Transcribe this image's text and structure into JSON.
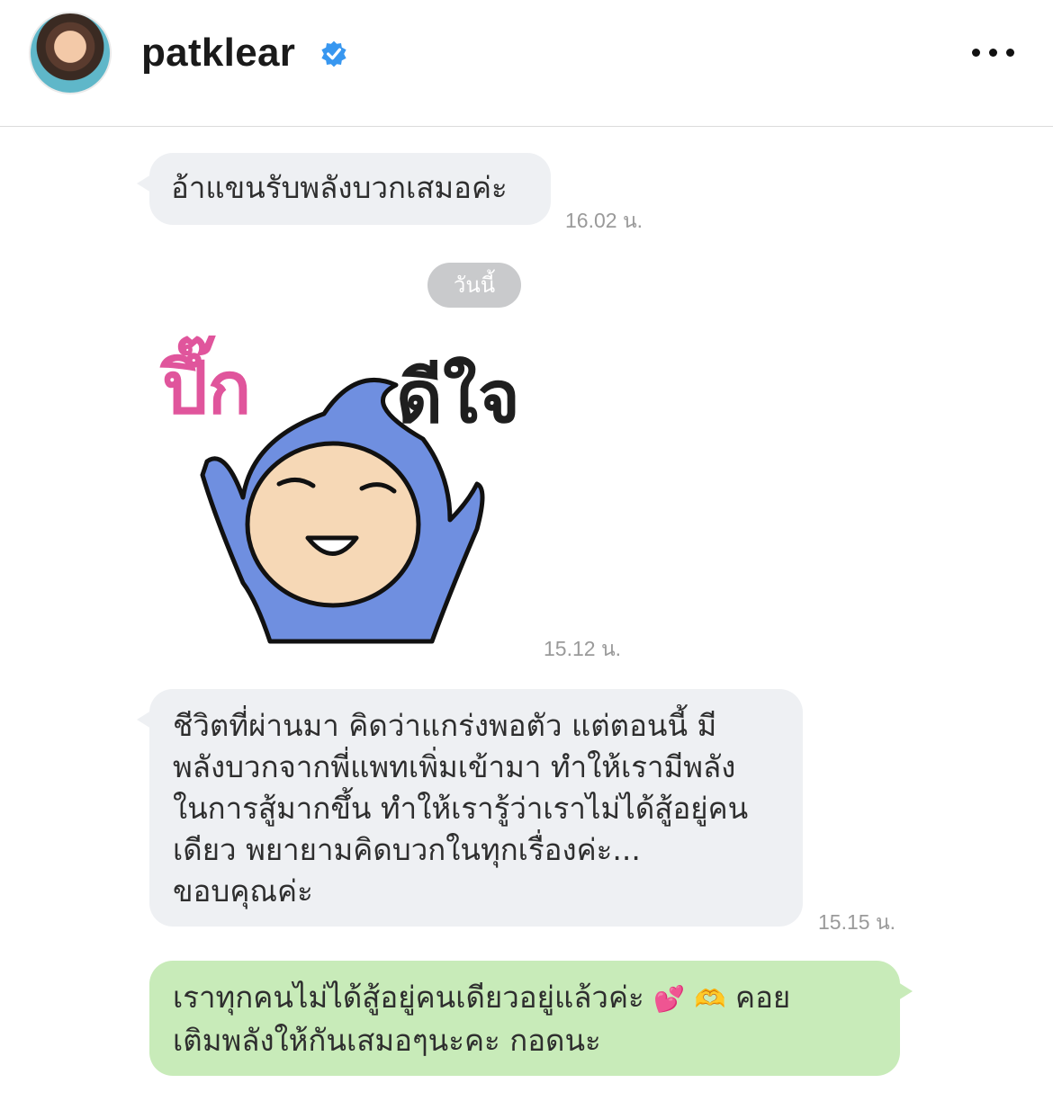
{
  "header": {
    "username": "patklear",
    "verified_icon": "verified-badge-icon",
    "more_icon": "more-options-icon"
  },
  "messages": [
    {
      "direction": "incoming",
      "text": "อ้าแขนรับพลังบวกเสมอค่ะ",
      "time": "16.02 น."
    },
    {
      "direction": "incoming",
      "type": "sticker",
      "sticker_text_left": "ปึ๊ก",
      "sticker_text_right": "ดีใจ",
      "time": "15.12 น."
    },
    {
      "direction": "incoming",
      "lines": [
        "ชีวิตที่ผ่านมา คิดว่าแกร่งพอตัว แต่ตอนนี้ มี",
        "พลังบวกจากพี่แพทเพิ่มเข้ามา ทำให้เรามีพลัง",
        "ในการสู้มากขึ้น ทำให้เรารู้ว่าเราไม่ได้สู้อยู่คน",
        "เดียว พยายามคิดบวกในทุกเรื่องค่ะ...",
        "ขอบคุณค่ะ"
      ],
      "time": "15.15 น."
    },
    {
      "direction": "outgoing",
      "line1_a": "เราทุกคนไม่ได้สู้อยู่คนเดียวอยู่แล้วค่ะ",
      "emoji1": "💕",
      "emoji2": "🫶",
      "line1_b": "คอย",
      "line2": "เติมพลังให้กันเสมอๆนะคะ กอดนะ"
    }
  ],
  "date_separator": "วันนี้",
  "colors": {
    "incoming_bubble": "#eef0f3",
    "outgoing_bubble": "#c8ebb9",
    "verified_blue": "#3897f0",
    "sticker_pink": "#e0559c",
    "sticker_character": "#6f8fe0"
  }
}
